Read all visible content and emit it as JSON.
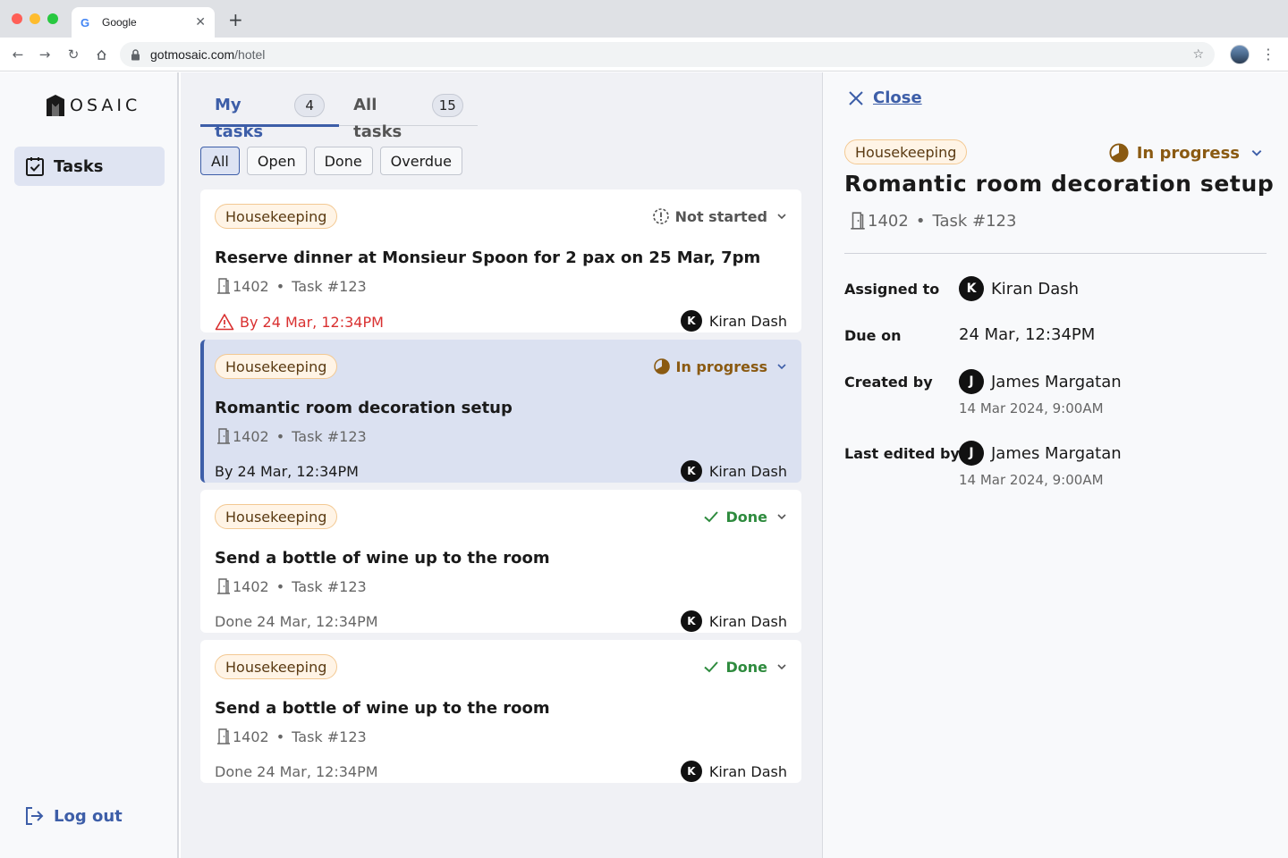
{
  "browser": {
    "tab_title": "Google",
    "url_host": "gotmosaic.com",
    "url_path": "/hotel"
  },
  "sidebar": {
    "logo_text": "OSAIC",
    "nav_tasks": "Tasks",
    "logout": "Log out"
  },
  "tabs": [
    {
      "label": "My tasks",
      "count": "4"
    },
    {
      "label": "All tasks",
      "count": "15"
    }
  ],
  "filters": [
    "All",
    "Open",
    "Done",
    "Overdue"
  ],
  "tasks": [
    {
      "category": "Housekeeping",
      "status": "Not started",
      "title": "Reserve dinner at Monsieur Spoon for 2 pax on 25 Mar, 7pm",
      "room": "1402",
      "dot": "•",
      "task_id": "Task #123",
      "due": "By 24 Mar, 12:34PM",
      "assignee_initial": "K",
      "assignee": "Kiran Dash"
    },
    {
      "category": "Housekeeping",
      "status": "In progress",
      "title": "Romantic room decoration setup",
      "room": "1402",
      "dot": "•",
      "task_id": "Task #123",
      "due": "By 24 Mar, 12:34PM",
      "assignee_initial": "K",
      "assignee": "Kiran Dash"
    },
    {
      "category": "Housekeeping",
      "status": "Done",
      "title": "Send a bottle of wine up to the room",
      "room": "1402",
      "dot": "•",
      "task_id": "Task #123",
      "due": "Done 24 Mar, 12:34PM",
      "assignee_initial": "K",
      "assignee": "Kiran Dash"
    },
    {
      "category": "Housekeeping",
      "status": "Done",
      "title": "Send a bottle of wine up to the room",
      "room": "1402",
      "dot": "•",
      "task_id": "Task #123",
      "due": "Done 24 Mar, 12:34PM",
      "assignee_initial": "K",
      "assignee": "Kiran Dash"
    }
  ],
  "detail": {
    "close": "Close",
    "category": "Housekeeping",
    "status": "In progress",
    "title": "Romantic room decoration setup",
    "room": "1402",
    "dot": "•",
    "task_id": "Task #123",
    "assigned_label": "Assigned to",
    "assigned_initial": "K",
    "assigned_name": "Kiran Dash",
    "due_label": "Due on",
    "due_value": "24 Mar, 12:34PM",
    "created_label": "Created by",
    "created_initial": "J",
    "created_name": "James Margatan",
    "created_date": "14 Mar 2024, 9:00AM",
    "edited_label": "Last edited by",
    "edited_initial": "J",
    "edited_name": "James Margatan",
    "edited_date": "14 Mar 2024, 9:00AM"
  },
  "colors": {
    "accent": "#3d5ea8",
    "overdue": "#d93030",
    "in_progress": "#8a5a12",
    "done": "#2e8b3e",
    "not_started": "#555555",
    "tag_bg": "#fff4e6"
  },
  "icons": {
    "status_not_started": "dashed-clock-icon",
    "status_in_progress": "half-circle-icon",
    "status_done": "check-icon",
    "room": "door-icon",
    "overdue": "warning-triangle-icon"
  }
}
